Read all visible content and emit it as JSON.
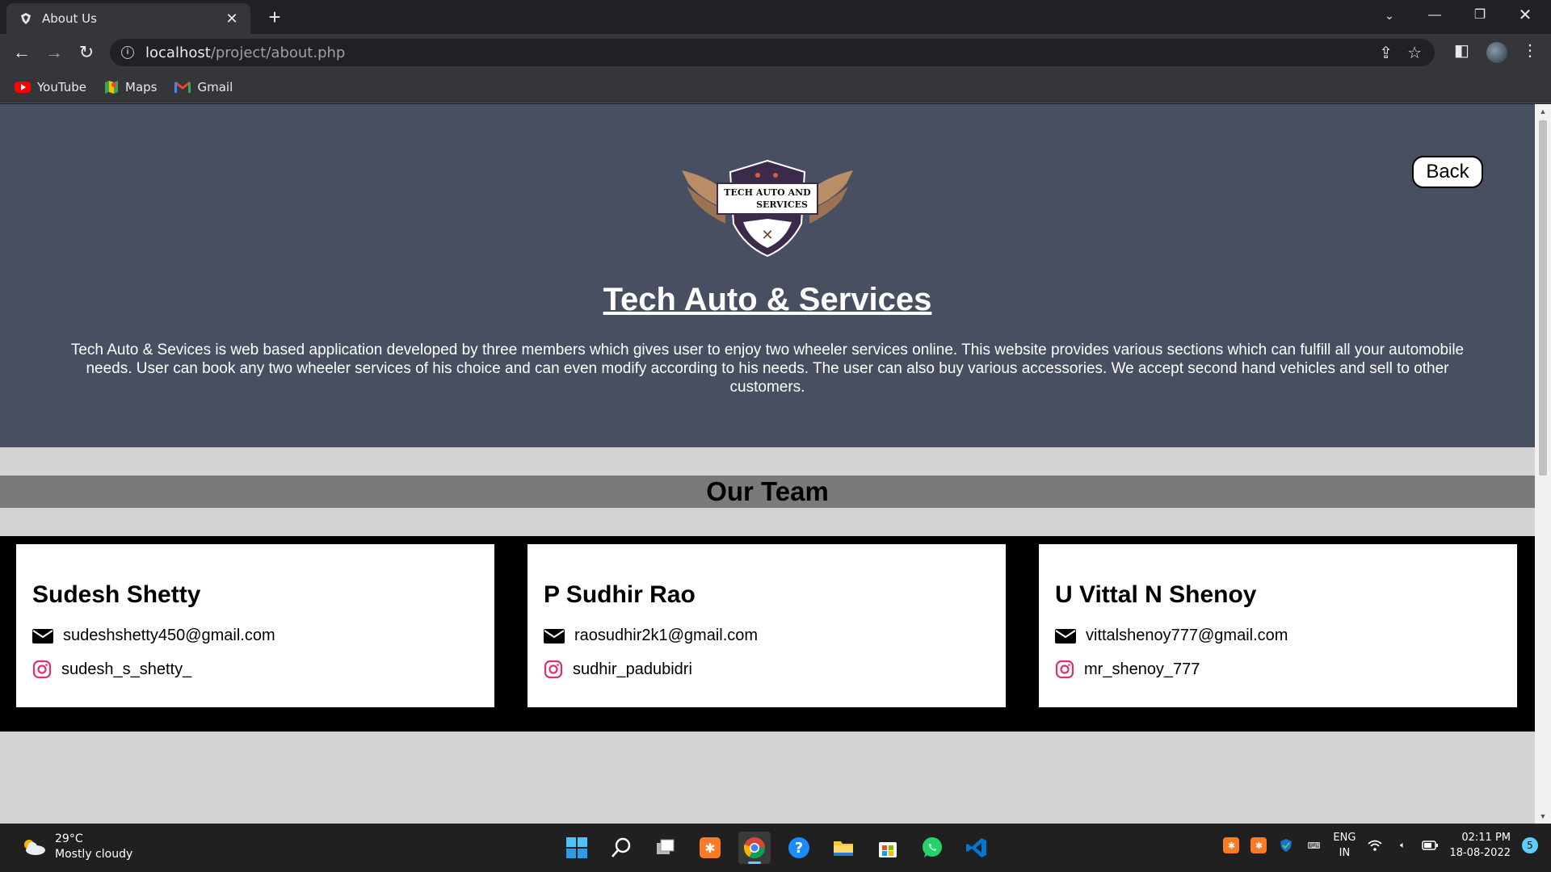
{
  "browser": {
    "tab_title": "About Us",
    "tab_close": "✕",
    "new_tab": "+",
    "url_host": "localhost",
    "url_path": "/project/about.php",
    "bookmarks": [
      {
        "label": "YouTube"
      },
      {
        "label": "Maps"
      },
      {
        "label": "Gmail"
      }
    ]
  },
  "page": {
    "logo_line1": "TECH AUTO AND",
    "logo_line2": "SERVICES",
    "title": "Tech Auto & Services",
    "description": "Tech Auto & Sevices is web based application developed by three members which gives user to enjoy two wheeler services online. This website provides various sections which can fulfill all your automobile needs. User can book any two wheeler services of his choice and can even modify according to his needs. The user can also buy various accessories. We accept second hand vehicles and sell to other customers.",
    "back_label": "Back",
    "team_heading": "Our Team",
    "team": [
      {
        "name": "Sudesh Shetty",
        "email": "sudeshshetty450@gmail.com",
        "instagram": "sudesh_s_shetty_"
      },
      {
        "name": "P Sudhir Rao",
        "email": "raosudhir2k1@gmail.com",
        "instagram": "sudhir_padubidri"
      },
      {
        "name": "U Vittal N Shenoy",
        "email": "vittalshenoy777@gmail.com",
        "instagram": "mr_shenoy_777"
      }
    ]
  },
  "taskbar": {
    "temperature": "29°C",
    "weather": "Mostly cloudy",
    "lang_line1": "ENG",
    "lang_line2": "IN",
    "time": "02:11 PM",
    "date": "18-08-2022",
    "notifications": "5"
  },
  "colors": {
    "hero_bg": "#474f61",
    "team_bar": "#7a7a7a",
    "page_bg": "#d3d3d3",
    "instagram_icon": "#e1306c"
  }
}
